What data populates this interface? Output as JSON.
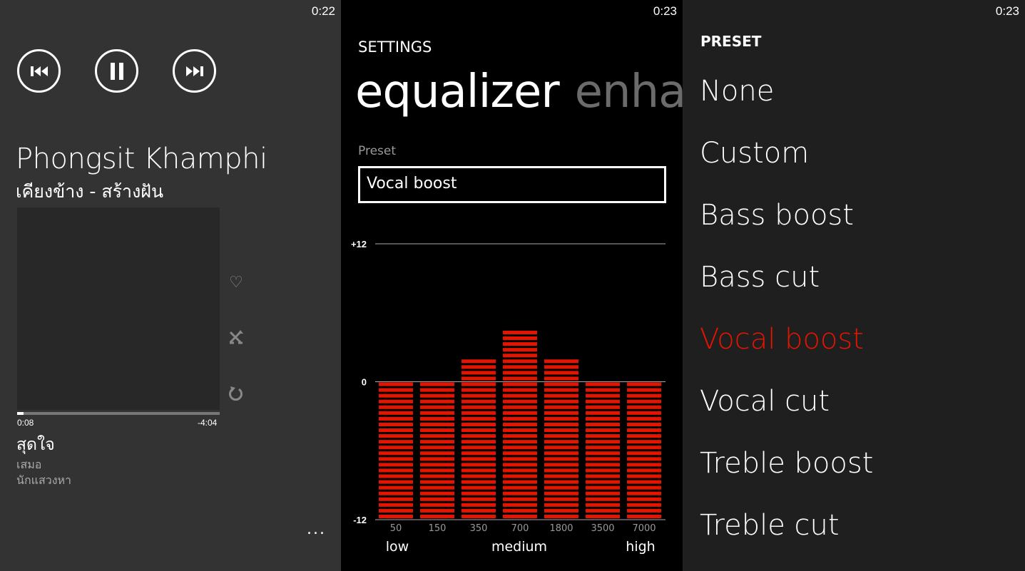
{
  "player": {
    "clock": "0:22",
    "controls": {
      "previous": "previous-icon",
      "pause": "pause-icon",
      "next": "next-icon"
    },
    "artist": "Phongsit Khamphi",
    "album_line": "เคียงข้าง - สร้างฝัน",
    "elapsed": "0:08",
    "remaining": "-4:04",
    "progress_fraction": 0.033,
    "song": "สุดใจ",
    "next_songs": [
      "เสมอ",
      "นักแสวงหา"
    ],
    "side_icons": [
      "heart-icon",
      "shuffle-icon",
      "repeat-icon"
    ],
    "more": "..."
  },
  "equalizer": {
    "clock": "0:23",
    "settings_title": "SETTINGS",
    "pivot": {
      "active": "equalizer",
      "inactive": "enha"
    },
    "preset_label": "Preset",
    "preset_value": "Vocal boost",
    "accent_color": "#e51400",
    "chart_data": {
      "type": "bar",
      "categories": [
        "50",
        "150",
        "350",
        "700",
        "1800",
        "3500",
        "7000"
      ],
      "values": [
        0,
        0,
        2,
        4.5,
        2,
        0,
        0
      ],
      "ylim": [
        -12,
        12
      ],
      "ytick_labels": [
        "+12",
        "0",
        "-12"
      ],
      "band_labels": [
        "low",
        "medium",
        "high"
      ]
    }
  },
  "preset_list": {
    "clock": "0:23",
    "header": "PRESET",
    "items": [
      "None",
      "Custom",
      "Bass boost",
      "Bass cut",
      "Vocal boost",
      "Vocal cut",
      "Treble boost",
      "Treble cut"
    ],
    "selected": "Vocal boost",
    "selected_color": "#e51400"
  }
}
